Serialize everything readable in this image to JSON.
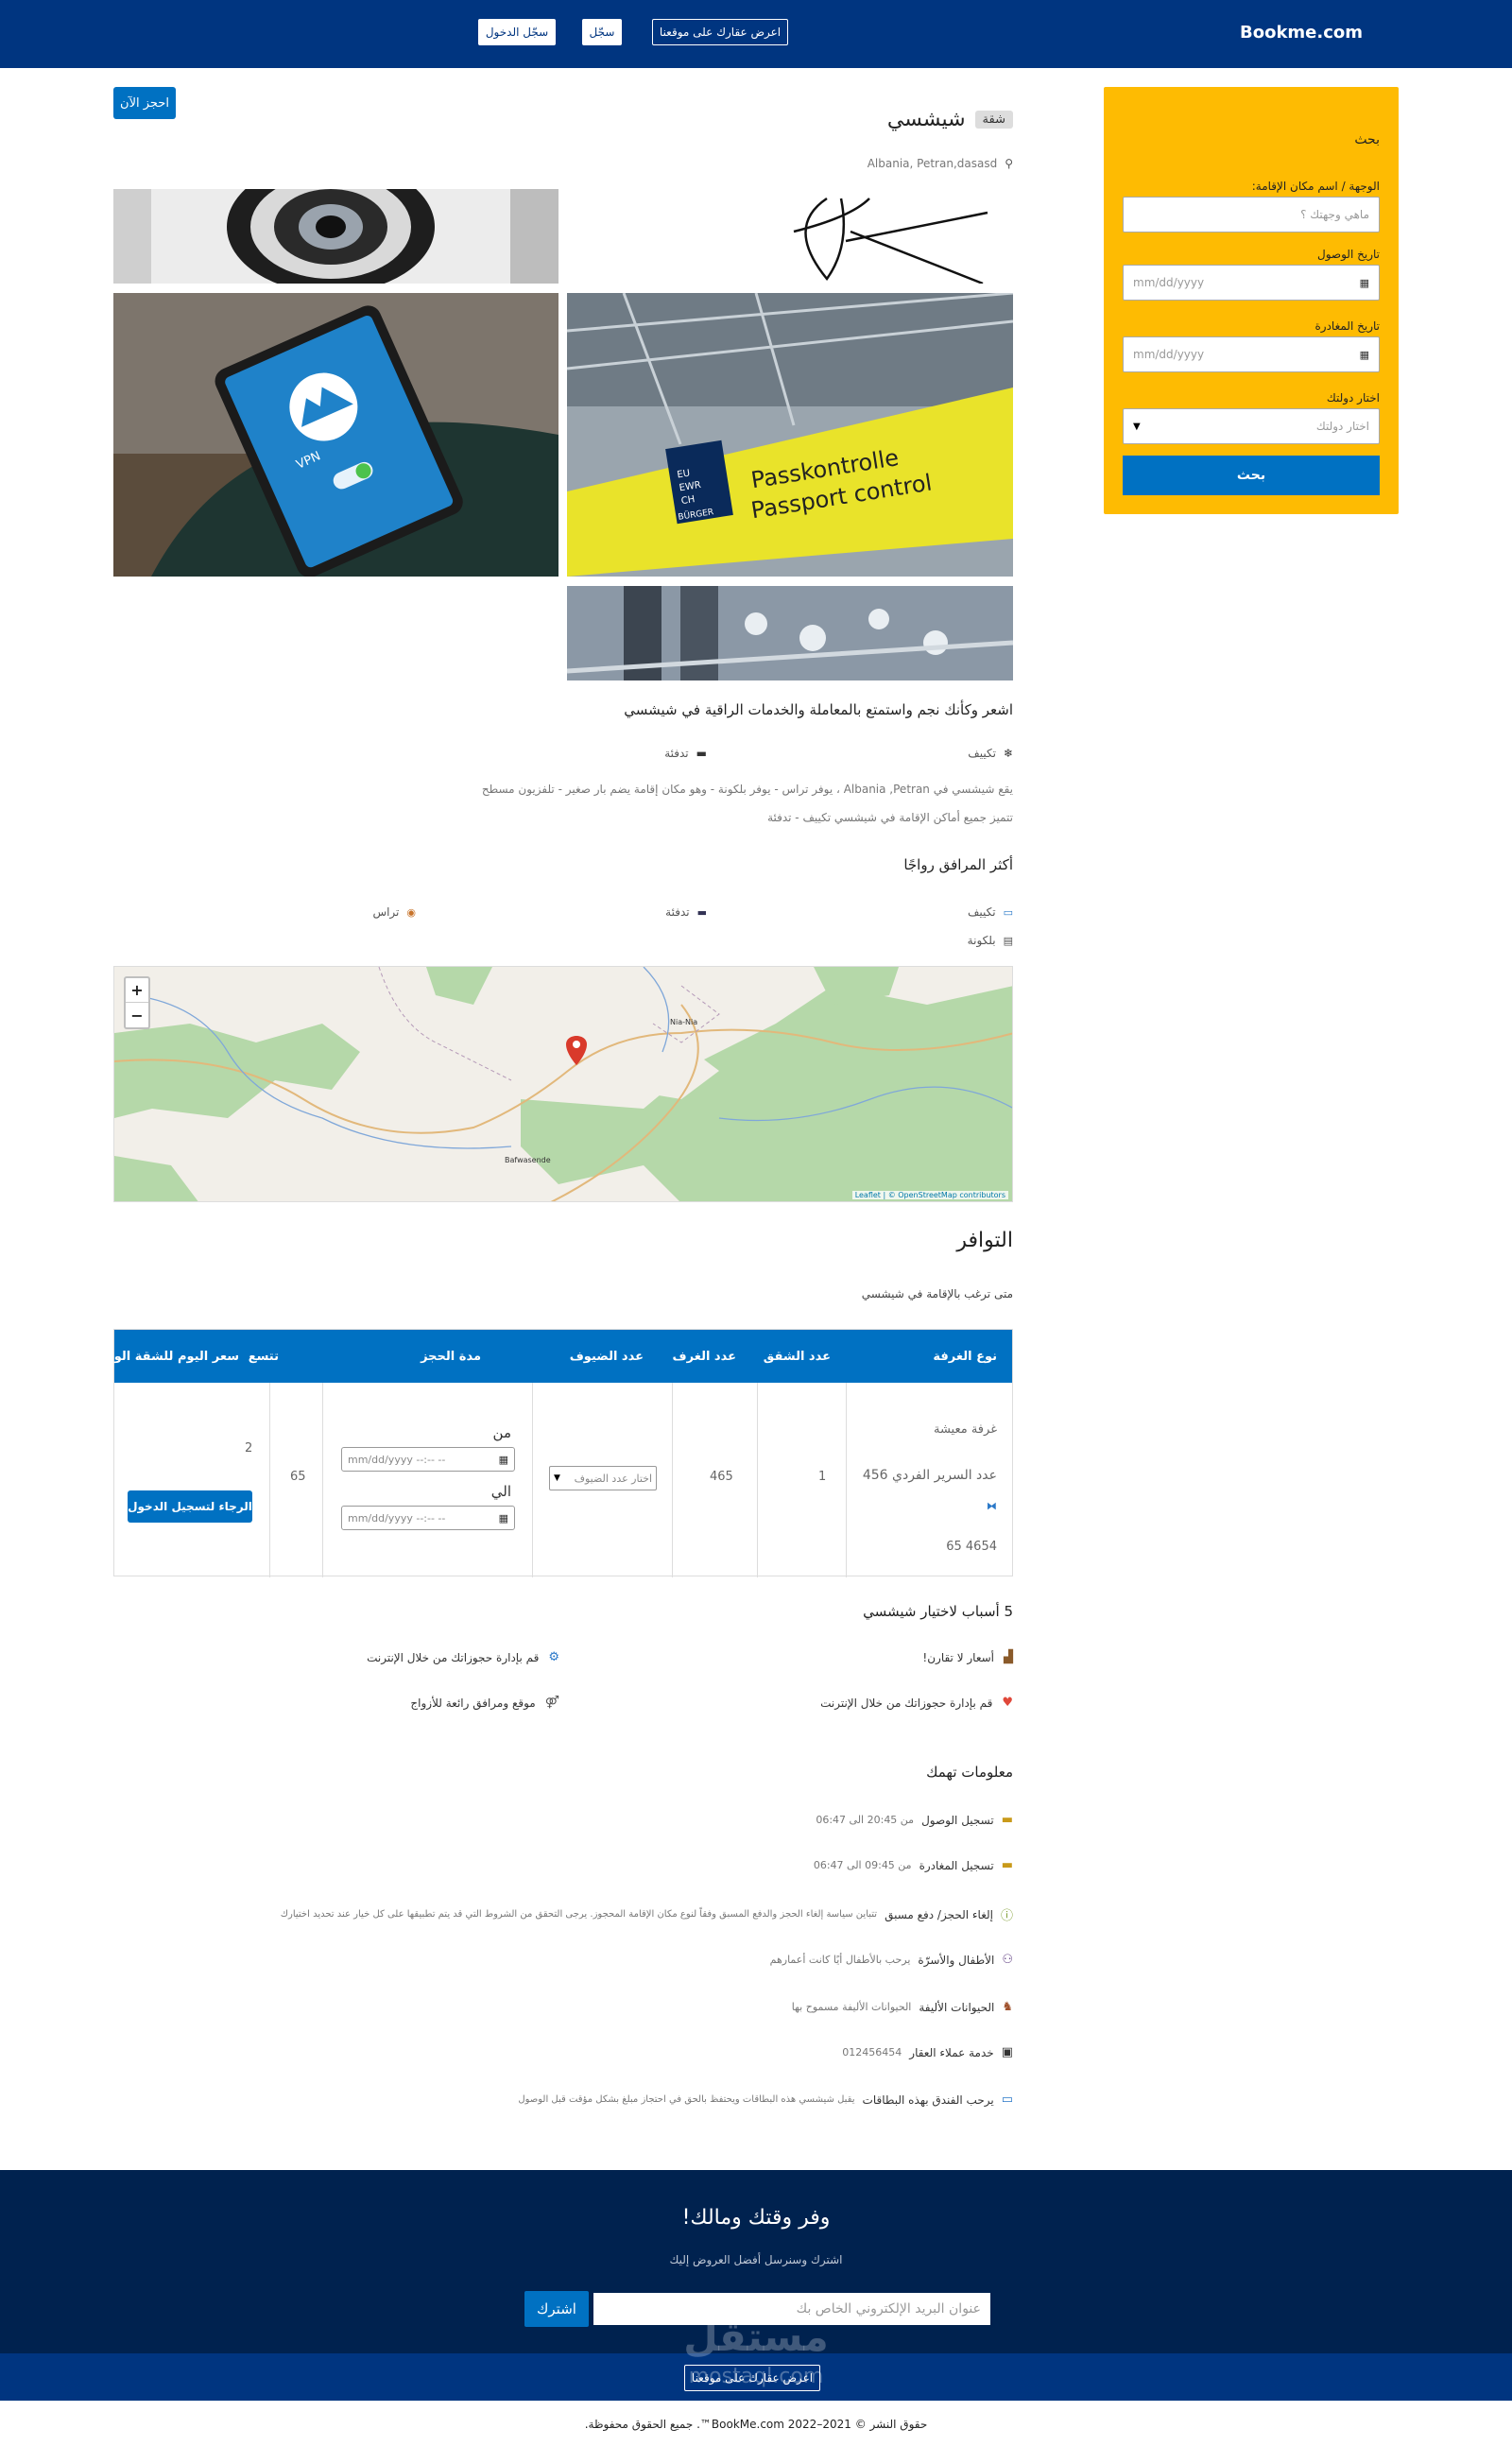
{
  "header": {
    "brand": "Bookme.com",
    "list_property": "اعرض عقارك على موقعنا",
    "register": "سجّل",
    "login": "سجّل الدخول"
  },
  "search": {
    "title": "بحث",
    "destination_label": "الوجهة / اسم مكان الإقامة:",
    "destination_placeholder": "ماهي وجهتك ؟",
    "checkin_label": "تاريخ الوصول",
    "checkin_placeholder": "mm/dd/yyyy",
    "checkout_label": "تاريخ المغادرة",
    "checkout_placeholder": "mm/dd/yyyy",
    "country_label": "اختار دولتك",
    "country_placeholder": "اختار دولتك",
    "button": "بحث"
  },
  "property": {
    "book_now": "احجز الآن",
    "type_badge": "شقة",
    "name": "شيشسي",
    "address": "Albania, Petran,dasasd",
    "tagline": "اشعر وكأنك نجم واستمتع بالمعاملة والخدمات الراقية في شيشسي",
    "quick_features": [
      "تكييف",
      "تدفئة"
    ],
    "description_1": "يقع شيشسي في Albania ,Petran ، يوفر تراس - يوفر بلكونة - وهو مكان إقامة يضم بار صغير - تلفزيون مسطح",
    "description_2": "تتميز جميع أماكن الإقامة في شيشسي تكييف - تدفئة",
    "photo_labels": [
      "VPN",
      "Passkontrolle",
      "Passport control",
      "EU",
      "EWR",
      "CH",
      "BÜRGER"
    ]
  },
  "facilities": {
    "title": "أكثر المرافق رواجًا",
    "items": [
      "تكييف",
      "تدفئة",
      "تراس",
      "بلكونة"
    ]
  },
  "map": {
    "zoom_in": "+",
    "zoom_out": "−",
    "place_1": "Nia-Nia",
    "place_2": "Bafwasende",
    "attribution": "Leaflet | © OpenStreetMap contributors"
  },
  "availability": {
    "title": "التوافر",
    "subtitle": "متى ترغب بالإقامة في شيشسي",
    "headers": [
      "نوع الغرفة",
      "عدد الشقق",
      "عدد الغرف",
      "عدد الضيوف",
      "مدة الحجز",
      "تتسع",
      "سعر اليوم للشقة الواحدة"
    ],
    "row": {
      "room_type": "غرفة معيشة",
      "bed_count": "عدد السرير الفردي 456",
      "dims": "65   4654",
      "apartments": "1",
      "rooms": "465",
      "guests_placeholder": "اختار عدد الضيوف",
      "from_label": "من",
      "to_label": "الي",
      "date_placeholder": "mm/dd/yyyy --:-- --",
      "capacity": "65",
      "price": "2",
      "login_button": "الرجاء لتسجيل الدخول"
    }
  },
  "reasons": {
    "title": "5 أسباب لاختيار شيشسي",
    "items": [
      "أسعار لا تقارن!",
      "قم بإدارة حجوزاتك من خلال الإنترنت",
      "قم بإدارة حجوزاتك من خلال الإنترنت",
      "موقع ومرافق رائعة للأزواج"
    ]
  },
  "info": {
    "title": "معلومات تهمك",
    "rows": [
      {
        "label": "تسجيل الوصول",
        "value": "من 20:45 الى 06:47"
      },
      {
        "label": "تسجيل المغادرة",
        "value": "من 09:45 الى 06:47"
      },
      {
        "label": "إلغاء الحجز/ دفع مسبق",
        "value": "تتباين سياسة إلغاء الحجز والدفع المسبق وفقاً لنوع مكان الإقامة المحجوز. يرجى التحقق من الشروط التي قد يتم تطبيقها على كل خيار عند تحديد اختيارك"
      },
      {
        "label": "الأطفال والأسرّة",
        "value": "يرحب بالأطفال أيًا كانت أعمارهم"
      },
      {
        "label": "الحيوانات الأليفة",
        "value": "الحيوانات الأليفة مسموح بها"
      },
      {
        "label": "خدمة عملاء العقار",
        "value": "012456454"
      },
      {
        "label": "يرحب الفندق بهذه البطاقات",
        "value": "يقبل شيشسي هذه البطاقات ويحتفظ بالحق في احتجاز مبلغ بشكل مؤقت قبل الوصول"
      }
    ]
  },
  "newsletter": {
    "title": "وفر وقتك ومالك!",
    "subtitle": "اشترك وسنرسل أفضل العروض إليك",
    "email_placeholder": "عنوان البريد الإلكتروني الخاص بك",
    "subscribe": "اشترك"
  },
  "footer": {
    "list_property": "اعرض عقارك على موقعنا",
    "copyright": "حقوق النشر © 2021–2022 BookMe.com™. جميع الحقوق محفوظة.",
    "watermark": "مستقل",
    "watermark_sub": "mostaql.com"
  },
  "colors": {
    "brand_dark": "#003580",
    "accent_yellow": "#febb02",
    "button_blue": "#0071c2",
    "newsletter_bg": "#00224f"
  }
}
